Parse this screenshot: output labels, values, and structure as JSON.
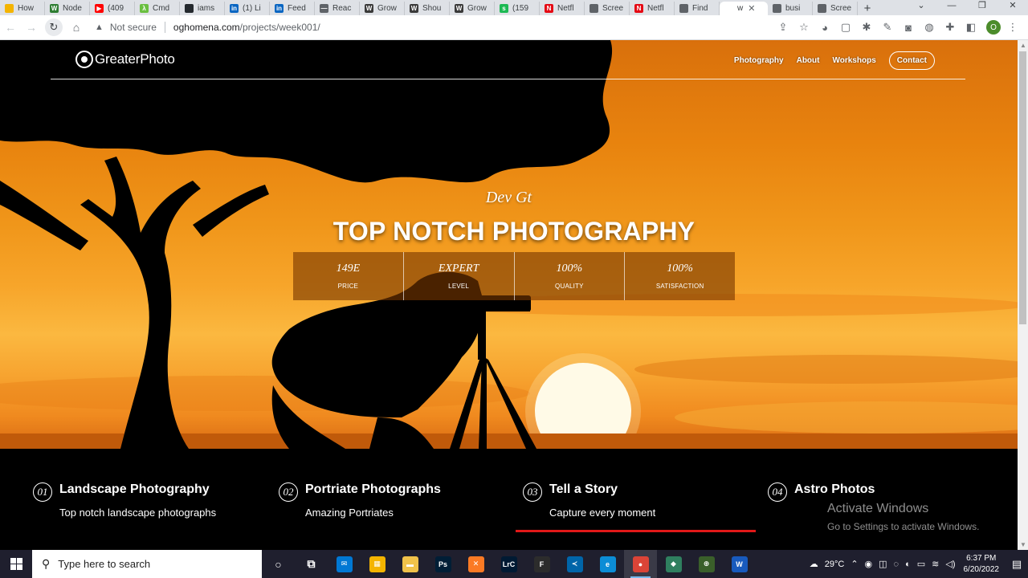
{
  "browser": {
    "tabs": [
      {
        "label": "How",
        "color": "#f4b400",
        "glyph": ""
      },
      {
        "label": "Node",
        "color": "#2e7d32",
        "glyph": "W"
      },
      {
        "label": "(409",
        "color": "#ff0000",
        "glyph": "▶"
      },
      {
        "label": "Cmd",
        "color": "#6abf40",
        "glyph": "λ"
      },
      {
        "label": "iams",
        "color": "#24292e",
        "glyph": ""
      },
      {
        "label": "(1) Li",
        "color": "#0a66c2",
        "glyph": "in"
      },
      {
        "label": "Feed",
        "color": "#0a66c2",
        "glyph": "in"
      },
      {
        "label": "Reac",
        "color": "#5f6368",
        "glyph": "—"
      },
      {
        "label": "Grow",
        "color": "#3a3a3a",
        "glyph": "W"
      },
      {
        "label": "Shou",
        "color": "#3a3a3a",
        "glyph": "W"
      },
      {
        "label": "Grow",
        "color": "#3a3a3a",
        "glyph": "W"
      },
      {
        "label": "(159",
        "color": "#1db954",
        "glyph": "s"
      },
      {
        "label": "Netfl",
        "color": "#e50914",
        "glyph": "N"
      },
      {
        "label": "Scree",
        "color": "#5f6368",
        "glyph": ""
      },
      {
        "label": "Netfl",
        "color": "#e50914",
        "glyph": "N"
      },
      {
        "label": "Find",
        "color": "#5f6368",
        "glyph": ""
      },
      {
        "label": "w",
        "color": "#ffffff",
        "glyph": "",
        "active": true
      },
      {
        "label": "busi",
        "color": "#5f6368",
        "glyph": ""
      },
      {
        "label": "Scree",
        "color": "#5f6368",
        "glyph": ""
      }
    ],
    "new_tab": "+",
    "window_controls": [
      "⌄",
      "—",
      "❐",
      "✕"
    ],
    "security_label": "Not secure",
    "url_host": "oghomena.com",
    "url_path": "/projects/week001/",
    "profile_initial": "O"
  },
  "site": {
    "logo_text": "GreaterPhoto",
    "nav": {
      "photography": "Photography",
      "about": "About",
      "workshops": "Workshops",
      "contact": "Contact"
    },
    "hero": {
      "subtitle": "Dev Gt",
      "headline": "TOP NOTCH PHOTOGRAPHY"
    },
    "stats": [
      {
        "value": "149E",
        "label": "PRICE"
      },
      {
        "value": "EXPERT",
        "label": "LEVEL"
      },
      {
        "value": "100%",
        "label": "QUALITY"
      },
      {
        "value": "100%",
        "label": "SATISFACTION"
      }
    ],
    "features": [
      {
        "num": "01",
        "title": "Landscape Photography",
        "text": "Top notch landscape photographs"
      },
      {
        "num": "02",
        "title": "Portriate Photographs",
        "text": "Amazing Portriates"
      },
      {
        "num": "03",
        "title": "Tell a Story",
        "text": "Capture every moment"
      },
      {
        "num": "04",
        "title": "Astro Photos",
        "text": ""
      }
    ],
    "accent_color": "#e01818"
  },
  "watermark": {
    "line1": "Activate Windows",
    "line2": "Go to Settings to activate Windows."
  },
  "taskbar": {
    "search_placeholder": "Type here to search",
    "weather": "29°C",
    "time": "6:37 PM",
    "date": "6/20/2022",
    "apps": [
      {
        "name": "cortana",
        "color": "transparent",
        "glyph": "○"
      },
      {
        "name": "task-view",
        "color": "transparent",
        "glyph": "⧉"
      },
      {
        "name": "mail",
        "color": "#0078d4",
        "glyph": "✉"
      },
      {
        "name": "store",
        "color": "#f4b400",
        "glyph": "▦"
      },
      {
        "name": "file-explorer",
        "color": "#f0c24a",
        "glyph": "▬"
      },
      {
        "name": "photoshop",
        "color": "#001e36",
        "glyph": "Ps"
      },
      {
        "name": "xampp",
        "color": "#fb7a24",
        "glyph": "✕"
      },
      {
        "name": "lightroom",
        "color": "#001a33",
        "glyph": "LrC"
      },
      {
        "name": "figma",
        "color": "#2c2c2c",
        "glyph": "F"
      },
      {
        "name": "vscode",
        "color": "#0065a9",
        "glyph": "≺"
      },
      {
        "name": "edge",
        "color": "#0c8dd6",
        "glyph": "e"
      },
      {
        "name": "chrome",
        "color": "#db4437",
        "glyph": "●",
        "active": true
      },
      {
        "name": "sourcetree",
        "color": "#2f7f5f",
        "glyph": "◆"
      },
      {
        "name": "app-green",
        "color": "#3a5f2a",
        "glyph": "⊕"
      },
      {
        "name": "word",
        "color": "#185abd",
        "glyph": "W"
      }
    ]
  }
}
